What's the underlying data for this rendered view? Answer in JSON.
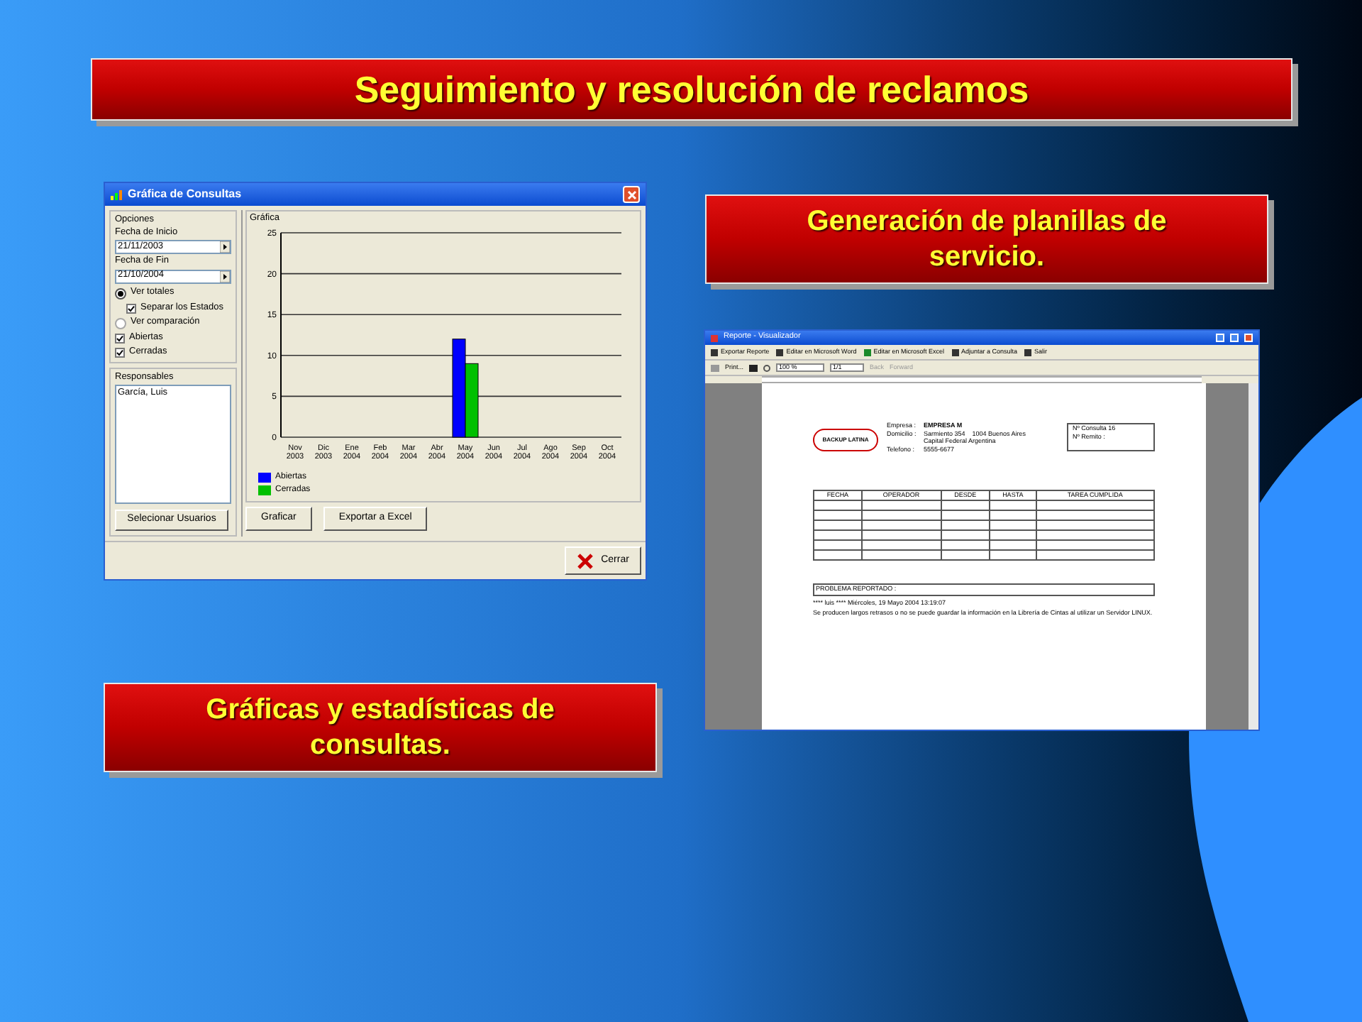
{
  "slide": {
    "title": "Seguimiento y resolución de reclamos",
    "callouts": [
      {
        "text": "Generación de planillas de servicio."
      },
      {
        "text": "Gráficas y estadísticas de consultas."
      }
    ]
  },
  "chart_window": {
    "title": "Gráfica de Consultas",
    "options_label": "Opciones",
    "start_label": "Fecha de Inicio",
    "start_value": "21/11/2003",
    "end_label": "Fecha de Fin",
    "end_value": "21/10/2004",
    "options": [
      {
        "kind": "radio",
        "label": "Ver totales",
        "selected": true
      },
      {
        "kind": "subcheckbox",
        "label": "Separar los Estados",
        "checked": true
      },
      {
        "kind": "radio",
        "label": "Ver comparación",
        "selected": false
      },
      {
        "kind": "checkbox",
        "label": "Abiertas",
        "checked": true
      },
      {
        "kind": "checkbox",
        "label": "Cerradas",
        "checked": true
      }
    ],
    "responsables_label": "Responsables",
    "responsables": [
      "García, Luis"
    ],
    "select_users_button": "Selecionar Usuarios",
    "chart_label": "Gráfica",
    "chart_data": {
      "type": "bar",
      "grid": true,
      "categories": [
        "Nov 2003",
        "Dic 2003",
        "Ene 2004",
        "Feb 2004",
        "Mar 2004",
        "Abr 2004",
        "May 2004",
        "Jun 2004",
        "Jul 2004",
        "Ago 2004",
        "Sep 2004",
        "Oct 2004"
      ],
      "ylim": [
        0,
        25
      ],
      "yticks": [
        0,
        5,
        10,
        15,
        20,
        25
      ],
      "series": [
        {
          "name": "Abiertas",
          "color": "#0000ff",
          "values": [
            0,
            0,
            0,
            0,
            0,
            0,
            12,
            0,
            0,
            0,
            0,
            0
          ]
        },
        {
          "name": "Cerradas",
          "color": "#00c000",
          "values": [
            0,
            0,
            0,
            0,
            0,
            0,
            9,
            0,
            0,
            0,
            0,
            0
          ]
        }
      ]
    },
    "buttons": [
      "Graficar",
      "Exportar a Excel"
    ],
    "close_button": "Cerrar"
  },
  "report_window": {
    "title": "Reporte - Visualizador",
    "toolbar": [
      "Exportar Reporte",
      "Editar en Microsoft Word",
      "Editar en Microsoft Excel",
      "Adjuntar a Consulta",
      "Salir"
    ],
    "print_button": "Print...",
    "zoom_value": "100 %",
    "page_value": "1/1",
    "back_button": "Back",
    "forward_button": "Forward",
    "logo_text": "BACKUP LATINA",
    "fields": [
      {
        "label": "Empresa :",
        "value": "EMPRESA M",
        "bold": true
      },
      {
        "label": "Domicilio :",
        "value": "Sarmiento 354    1004 Buenos Aires",
        "bold": false
      },
      {
        "value": "Capital Federal Argentina",
        "bold": false
      },
      {
        "label": "Telefono :",
        "value": "5555-6677",
        "bold": false
      }
    ],
    "ref_box": [
      "Nº Consulta 16",
      "Nº Remito :"
    ],
    "table_columns": [
      "FECHA",
      "OPERADOR",
      "DESDE",
      "HASTA",
      "TAREA CUMPLIDA"
    ],
    "problem_label": "PROBLEMA REPORTADO :",
    "problem_lines": [
      "**** luis **** Miércoles, 19 Mayo 2004 13:19:07",
      "Se producen largos retrasos o no se puede guardar la información en la Librería de Cintas al utilizar un Servidor LINUX."
    ]
  }
}
